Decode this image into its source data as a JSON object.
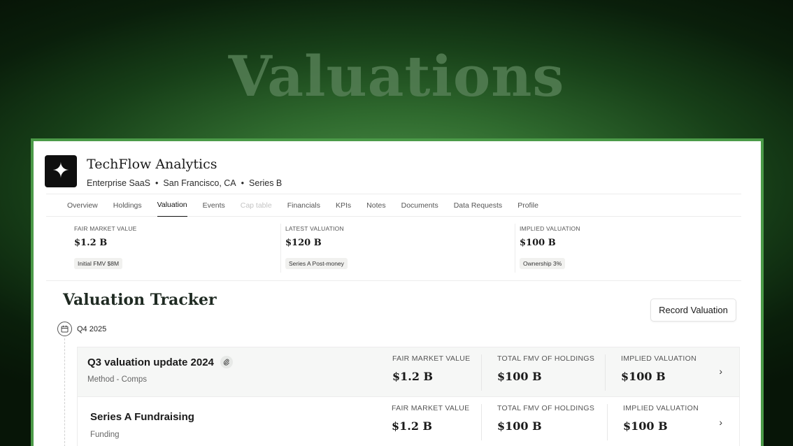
{
  "hero": {
    "title": "Valuations"
  },
  "company": {
    "name": "TechFlow Analytics",
    "meta": [
      "Enterprise SaaS",
      "San Francisco, CA",
      "Series B"
    ]
  },
  "tabs": [
    {
      "label": "Overview",
      "state": "normal"
    },
    {
      "label": "Holdings",
      "state": "normal"
    },
    {
      "label": "Valuation",
      "state": "active"
    },
    {
      "label": "Events",
      "state": "normal"
    },
    {
      "label": "Cap table",
      "state": "disabled"
    },
    {
      "label": "Financials",
      "state": "normal"
    },
    {
      "label": "KPIs",
      "state": "normal"
    },
    {
      "label": "Notes",
      "state": "normal"
    },
    {
      "label": "Documents",
      "state": "normal"
    },
    {
      "label": "Data Requests",
      "state": "normal"
    },
    {
      "label": "Profile",
      "state": "normal"
    }
  ],
  "stats": [
    {
      "label": "FAIR MARKET VALUE",
      "value": "$1.2 B",
      "tag": "Initial FMV $8M"
    },
    {
      "label": "LATEST VALUATION",
      "value": "$120 B",
      "tag": "Series A Post-money"
    },
    {
      "label": "IMPLIED VALUATION",
      "value": "$100 B",
      "tag": "Ownership 3%"
    }
  ],
  "tracker": {
    "title": "Valuation Tracker",
    "record_button": "Record Valuation",
    "quarter": "Q4 2025",
    "entries": [
      {
        "title": "Q3 valuation update 2024",
        "subtitle": "Method - Comps",
        "has_attachment": true,
        "metrics": [
          {
            "label": "FAIR MARKET VALUE",
            "value": "$1.2 B"
          },
          {
            "label": "TOTAL FMV OF HOLDINGS",
            "value": "$100 B"
          },
          {
            "label": "IMPLIED VALUATION",
            "value": "$100 B"
          }
        ]
      },
      {
        "title": "Series A Fundraising",
        "subtitle": "Funding",
        "has_attachment": false,
        "metrics": [
          {
            "label": "FAIR MARKET VALUE",
            "value": "$1.2 B"
          },
          {
            "label": "TOTAL FMV OF HOLDINGS",
            "value": "$100 B"
          },
          {
            "label": "IMPLIED VALUATION",
            "value": "$100 B"
          }
        ]
      }
    ]
  },
  "icons": {
    "logo": "four-point-star-icon",
    "calendar": "calendar-icon",
    "attachment": "paperclip-icon",
    "chevron": "chevron-right-icon"
  },
  "colors": {
    "accent_green": "#4b9a48",
    "text_dark": "#1a1a1a"
  }
}
